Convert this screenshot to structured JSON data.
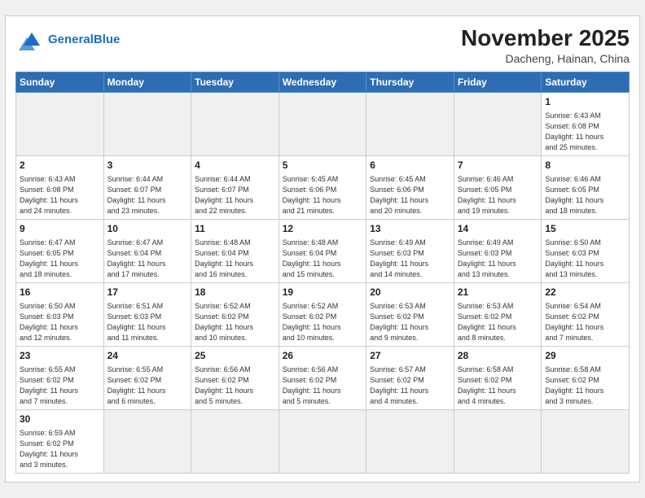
{
  "header": {
    "logo_general": "General",
    "logo_blue": "Blue",
    "month": "November 2025",
    "location": "Dacheng, Hainan, China"
  },
  "days_of_week": [
    "Sunday",
    "Monday",
    "Tuesday",
    "Wednesday",
    "Thursday",
    "Friday",
    "Saturday"
  ],
  "weeks": [
    [
      {
        "day": "",
        "info": ""
      },
      {
        "day": "",
        "info": ""
      },
      {
        "day": "",
        "info": ""
      },
      {
        "day": "",
        "info": ""
      },
      {
        "day": "",
        "info": ""
      },
      {
        "day": "",
        "info": ""
      },
      {
        "day": "1",
        "info": "Sunrise: 6:43 AM\nSunset: 6:08 PM\nDaylight: 11 hours\nand 25 minutes."
      }
    ],
    [
      {
        "day": "2",
        "info": "Sunrise: 6:43 AM\nSunset: 6:08 PM\nDaylight: 11 hours\nand 24 minutes."
      },
      {
        "day": "3",
        "info": "Sunrise: 6:44 AM\nSunset: 6:07 PM\nDaylight: 11 hours\nand 23 minutes."
      },
      {
        "day": "4",
        "info": "Sunrise: 6:44 AM\nSunset: 6:07 PM\nDaylight: 11 hours\nand 22 minutes."
      },
      {
        "day": "5",
        "info": "Sunrise: 6:45 AM\nSunset: 6:06 PM\nDaylight: 11 hours\nand 21 minutes."
      },
      {
        "day": "6",
        "info": "Sunrise: 6:45 AM\nSunset: 6:06 PM\nDaylight: 11 hours\nand 20 minutes."
      },
      {
        "day": "7",
        "info": "Sunrise: 6:46 AM\nSunset: 6:05 PM\nDaylight: 11 hours\nand 19 minutes."
      },
      {
        "day": "8",
        "info": "Sunrise: 6:46 AM\nSunset: 6:05 PM\nDaylight: 11 hours\nand 18 minutes."
      }
    ],
    [
      {
        "day": "9",
        "info": "Sunrise: 6:47 AM\nSunset: 6:05 PM\nDaylight: 11 hours\nand 18 minutes."
      },
      {
        "day": "10",
        "info": "Sunrise: 6:47 AM\nSunset: 6:04 PM\nDaylight: 11 hours\nand 17 minutes."
      },
      {
        "day": "11",
        "info": "Sunrise: 6:48 AM\nSunset: 6:04 PM\nDaylight: 11 hours\nand 16 minutes."
      },
      {
        "day": "12",
        "info": "Sunrise: 6:48 AM\nSunset: 6:04 PM\nDaylight: 11 hours\nand 15 minutes."
      },
      {
        "day": "13",
        "info": "Sunrise: 6:49 AM\nSunset: 6:03 PM\nDaylight: 11 hours\nand 14 minutes."
      },
      {
        "day": "14",
        "info": "Sunrise: 6:49 AM\nSunset: 6:03 PM\nDaylight: 11 hours\nand 13 minutes."
      },
      {
        "day": "15",
        "info": "Sunrise: 6:50 AM\nSunset: 6:03 PM\nDaylight: 11 hours\nand 13 minutes."
      }
    ],
    [
      {
        "day": "16",
        "info": "Sunrise: 6:50 AM\nSunset: 6:03 PM\nDaylight: 11 hours\nand 12 minutes."
      },
      {
        "day": "17",
        "info": "Sunrise: 6:51 AM\nSunset: 6:03 PM\nDaylight: 11 hours\nand 11 minutes."
      },
      {
        "day": "18",
        "info": "Sunrise: 6:52 AM\nSunset: 6:02 PM\nDaylight: 11 hours\nand 10 minutes."
      },
      {
        "day": "19",
        "info": "Sunrise: 6:52 AM\nSunset: 6:02 PM\nDaylight: 11 hours\nand 10 minutes."
      },
      {
        "day": "20",
        "info": "Sunrise: 6:53 AM\nSunset: 6:02 PM\nDaylight: 11 hours\nand 9 minutes."
      },
      {
        "day": "21",
        "info": "Sunrise: 6:53 AM\nSunset: 6:02 PM\nDaylight: 11 hours\nand 8 minutes."
      },
      {
        "day": "22",
        "info": "Sunrise: 6:54 AM\nSunset: 6:02 PM\nDaylight: 11 hours\nand 7 minutes."
      }
    ],
    [
      {
        "day": "23",
        "info": "Sunrise: 6:55 AM\nSunset: 6:02 PM\nDaylight: 11 hours\nand 7 minutes."
      },
      {
        "day": "24",
        "info": "Sunrise: 6:55 AM\nSunset: 6:02 PM\nDaylight: 11 hours\nand 6 minutes."
      },
      {
        "day": "25",
        "info": "Sunrise: 6:56 AM\nSunset: 6:02 PM\nDaylight: 11 hours\nand 5 minutes."
      },
      {
        "day": "26",
        "info": "Sunrise: 6:56 AM\nSunset: 6:02 PM\nDaylight: 11 hours\nand 5 minutes."
      },
      {
        "day": "27",
        "info": "Sunrise: 6:57 AM\nSunset: 6:02 PM\nDaylight: 11 hours\nand 4 minutes."
      },
      {
        "day": "28",
        "info": "Sunrise: 6:58 AM\nSunset: 6:02 PM\nDaylight: 11 hours\nand 4 minutes."
      },
      {
        "day": "29",
        "info": "Sunrise: 6:58 AM\nSunset: 6:02 PM\nDaylight: 11 hours\nand 3 minutes."
      }
    ],
    [
      {
        "day": "30",
        "info": "Sunrise: 6:59 AM\nSunset: 6:02 PM\nDaylight: 11 hours\nand 3 minutes."
      },
      {
        "day": "",
        "info": ""
      },
      {
        "day": "",
        "info": ""
      },
      {
        "day": "",
        "info": ""
      },
      {
        "day": "",
        "info": ""
      },
      {
        "day": "",
        "info": ""
      },
      {
        "day": "",
        "info": ""
      }
    ]
  ]
}
